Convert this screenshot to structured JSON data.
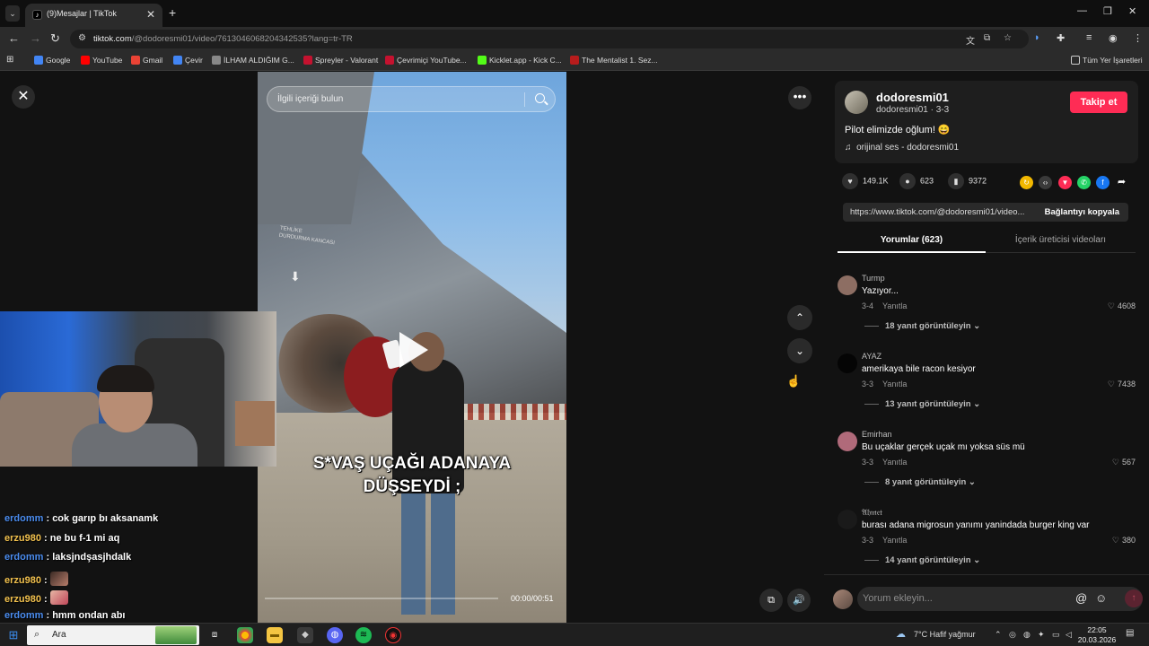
{
  "browser": {
    "tab_title": "(9)Mesajlar | TikTok",
    "url_host": "tiktok.com",
    "url_path": "/@dodoresmi01/video/7613046068204342535?lang=tr-TR",
    "bookmarks": [
      "Google",
      "YouTube",
      "Gmail",
      "Çevir",
      "İLHAM ALDIĞIM G...",
      "Spreyler - Valorant",
      "Çevrimiçi YouTube...",
      "Kicklet.app - Kick C...",
      "The Mentalist 1. Sez..."
    ],
    "bookmark_colors": [
      "#4285f4",
      "#ff0000",
      "#ea4335",
      "#4285f4",
      "#888888",
      "#c4122f",
      "#c4122f",
      "#53fc18",
      "#b71c1c"
    ],
    "all_bookmarks": "Tüm Yer İşaretleri"
  },
  "video": {
    "search_placeholder": "İlgili içeriği bulun",
    "caption_line1": "S*VAŞ UÇAĞI ADANAYA",
    "caption_line2": "DÜŞSEYDİ ;",
    "time": "00:00/00:51",
    "plane_label_1": "TEHLİKE",
    "plane_label_2": "DURDURMA KANCASI"
  },
  "chat": [
    {
      "user": "erdomm",
      "text": ": cok garıp bı aksanamk",
      "color": "blue"
    },
    {
      "user": "erzu980",
      "text": ": ne bu f-1 mi aq",
      "color": "yellow"
    },
    {
      "user": "erdomm",
      "text": ": laksjndşasjhdalk",
      "color": "blue"
    },
    {
      "user": "erzu980",
      "text": ":",
      "color": "yellow"
    },
    {
      "user": "erzu980",
      "text": ":",
      "color": "yellow"
    },
    {
      "user": "erdomm",
      "text": ": hmm ondan abı",
      "color": "blue"
    }
  ],
  "post": {
    "username": "dodoresmi01",
    "subline": "dodoresmi01 · 3-3",
    "follow_label": "Takip et",
    "description": "Pilot elimizde oğlum! 😄",
    "music": "orijinal ses - dodoresmi01",
    "likes": "149.1K",
    "comments": "623",
    "saves": "9372",
    "link_url": "https://www.tiktok.com/@dodoresmi01/video...",
    "copy_label": "Bağlantıyı kopyala",
    "tab_comments": "Yorumlar (623)",
    "tab_creator": "İçerik üreticisi videoları"
  },
  "comments": [
    {
      "user": "Turmp",
      "text": "Yazıyor...",
      "date": "3-4",
      "reply": "Yanıtla",
      "likes": "4608",
      "more": "18 yanıt görüntüleyin",
      "avatar_color": "#8d6e63"
    },
    {
      "user": "AYAZ",
      "text": "amerikaya bile racon kesiyor",
      "date": "3-3",
      "reply": "Yanıtla",
      "likes": "7438",
      "more": "13 yanıt görüntüleyin",
      "avatar_color": "#050505"
    },
    {
      "user": "Emirhan",
      "text": "Bu uçaklar gerçek uçak mı yoksa süs mü",
      "date": "3-3",
      "reply": "Yanıtla",
      "likes": "567",
      "more": "8 yanıt görüntüleyin",
      "avatar_color": "#b06a7a"
    },
    {
      "user": "𝔄𝔥𝔪𝔢𝔱",
      "text": "burası adana migrosun yanımı yanindada burger king var",
      "date": "3-3",
      "reply": "Yanıtla",
      "likes": "380",
      "more": "14 yanıt görüntüleyin",
      "avatar_color": "#1a1a1a"
    }
  ],
  "add_comment_placeholder": "Yorum ekleyin...",
  "taskbar": {
    "search_text": "Ara",
    "weather": "7°C  Hafif yağmur",
    "time": "22:05",
    "date": "20.03.2026"
  }
}
